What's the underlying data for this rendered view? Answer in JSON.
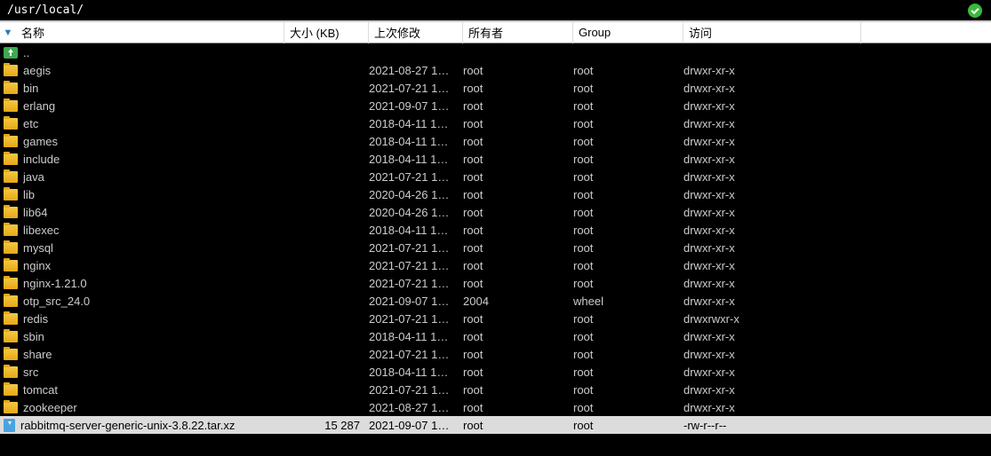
{
  "path": "/usr/local/",
  "columns": {
    "name": "名称",
    "size": "大小 (KB)",
    "modified": "上次修改",
    "owner": "所有者",
    "group": "Group",
    "perm": "访问"
  },
  "parent_label": "..",
  "rows": [
    {
      "icon": "folder",
      "name": "aegis",
      "size": "",
      "date": "2021-08-27 1…",
      "owner": "root",
      "group": "root",
      "perm": "drwxr-xr-x",
      "sel": false
    },
    {
      "icon": "folder",
      "name": "bin",
      "size": "",
      "date": "2021-07-21 1…",
      "owner": "root",
      "group": "root",
      "perm": "drwxr-xr-x",
      "sel": false
    },
    {
      "icon": "folder",
      "name": "erlang",
      "size": "",
      "date": "2021-09-07 1…",
      "owner": "root",
      "group": "root",
      "perm": "drwxr-xr-x",
      "sel": false
    },
    {
      "icon": "folder",
      "name": "etc",
      "size": "",
      "date": "2018-04-11 1…",
      "owner": "root",
      "group": "root",
      "perm": "drwxr-xr-x",
      "sel": false
    },
    {
      "icon": "folder",
      "name": "games",
      "size": "",
      "date": "2018-04-11 1…",
      "owner": "root",
      "group": "root",
      "perm": "drwxr-xr-x",
      "sel": false
    },
    {
      "icon": "folder",
      "name": "include",
      "size": "",
      "date": "2018-04-11 1…",
      "owner": "root",
      "group": "root",
      "perm": "drwxr-xr-x",
      "sel": false
    },
    {
      "icon": "folder",
      "name": "java",
      "size": "",
      "date": "2021-07-21 1…",
      "owner": "root",
      "group": "root",
      "perm": "drwxr-xr-x",
      "sel": false
    },
    {
      "icon": "folder",
      "name": "lib",
      "size": "",
      "date": "2020-04-26 1…",
      "owner": "root",
      "group": "root",
      "perm": "drwxr-xr-x",
      "sel": false
    },
    {
      "icon": "folder",
      "name": "lib64",
      "size": "",
      "date": "2020-04-26 1…",
      "owner": "root",
      "group": "root",
      "perm": "drwxr-xr-x",
      "sel": false
    },
    {
      "icon": "folder",
      "name": "libexec",
      "size": "",
      "date": "2018-04-11 1…",
      "owner": "root",
      "group": "root",
      "perm": "drwxr-xr-x",
      "sel": false
    },
    {
      "icon": "folder",
      "name": "mysql",
      "size": "",
      "date": "2021-07-21 1…",
      "owner": "root",
      "group": "root",
      "perm": "drwxr-xr-x",
      "sel": false
    },
    {
      "icon": "folder",
      "name": "nginx",
      "size": "",
      "date": "2021-07-21 1…",
      "owner": "root",
      "group": "root",
      "perm": "drwxr-xr-x",
      "sel": false
    },
    {
      "icon": "folder",
      "name": "nginx-1.21.0",
      "size": "",
      "date": "2021-07-21 1…",
      "owner": "root",
      "group": "root",
      "perm": "drwxr-xr-x",
      "sel": false
    },
    {
      "icon": "folder",
      "name": "otp_src_24.0",
      "size": "",
      "date": "2021-09-07 1…",
      "owner": "2004",
      "group": "wheel",
      "perm": "drwxr-xr-x",
      "sel": false
    },
    {
      "icon": "folder",
      "name": "redis",
      "size": "",
      "date": "2021-07-21 1…",
      "owner": "root",
      "group": "root",
      "perm": "drwxrwxr-x",
      "sel": false
    },
    {
      "icon": "folder",
      "name": "sbin",
      "size": "",
      "date": "2018-04-11 1…",
      "owner": "root",
      "group": "root",
      "perm": "drwxr-xr-x",
      "sel": false
    },
    {
      "icon": "folder",
      "name": "share",
      "size": "",
      "date": "2021-07-21 1…",
      "owner": "root",
      "group": "root",
      "perm": "drwxr-xr-x",
      "sel": false
    },
    {
      "icon": "folder",
      "name": "src",
      "size": "",
      "date": "2018-04-11 1…",
      "owner": "root",
      "group": "root",
      "perm": "drwxr-xr-x",
      "sel": false
    },
    {
      "icon": "folder",
      "name": "tomcat",
      "size": "",
      "date": "2021-07-21 1…",
      "owner": "root",
      "group": "root",
      "perm": "drwxr-xr-x",
      "sel": false
    },
    {
      "icon": "folder",
      "name": "zookeeper",
      "size": "",
      "date": "2021-08-27 1…",
      "owner": "root",
      "group": "root",
      "perm": "drwxr-xr-x",
      "sel": false
    },
    {
      "icon": "archive",
      "name": "rabbitmq-server-generic-unix-3.8.22.tar.xz",
      "size": "15 287",
      "date": "2021-09-07 1…",
      "owner": "root",
      "group": "root",
      "perm": "-rw-r--r--",
      "sel": true
    }
  ]
}
